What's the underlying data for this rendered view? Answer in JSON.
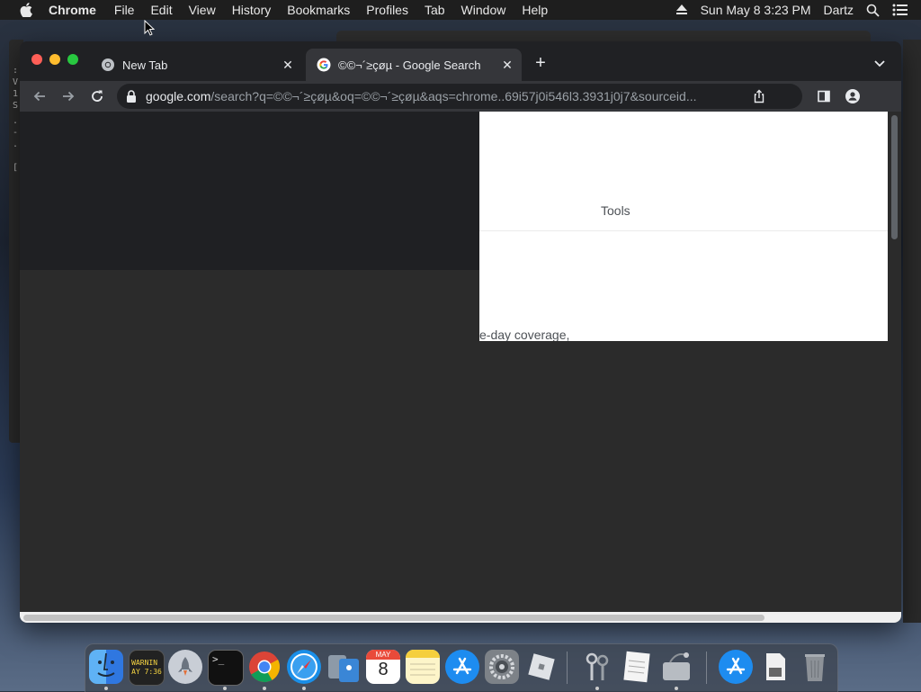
{
  "menubar": {
    "app_name": "Chrome",
    "items": [
      "File",
      "Edit",
      "View",
      "History",
      "Bookmarks",
      "Profiles",
      "Tab",
      "Window",
      "Help"
    ],
    "datetime": "Sun May 8  3:23 PM",
    "user": "Dartz"
  },
  "background_terminal": {
    "lines": [
      ":",
      "V",
      "1",
      "S",
      ".",
      "-",
      ".",
      "["
    ]
  },
  "browser": {
    "tabs": [
      {
        "label": "New Tab",
        "active": false
      },
      {
        "label": "©©¬´≥çøµ - Google Search",
        "active": true
      }
    ],
    "url_host": "google.com",
    "url_rest": "/search?q=©©¬´≥çøµ&oq=©©¬´≥çøµ&aqs=chrome..69i57j0i546l3.3931j0j7&sourceid..."
  },
  "page": {
    "tools_label": "Tools",
    "snippet_text": "e-day coverage,"
  },
  "dock": {
    "apps": [
      "finder-icon",
      "console-icon",
      "launchpad-icon",
      "terminal-icon",
      "chrome-icon",
      "safari-icon",
      "migration-icon",
      "calendar-icon",
      "notes-icon",
      "app-store-icon",
      "system-preferences-icon",
      "roblox-icon",
      "keychain-icon",
      "textedit-icon",
      "disk-utility-icon",
      "app-store-downloads-icon",
      "file-icon",
      "trash-icon"
    ],
    "console_text": "WARNIN\nAY 7:36",
    "calendar_month": "MAY",
    "calendar_day": "8"
  },
  "colors": {
    "menubar_bg": "#1e1e1e",
    "tabstrip_bg": "#202124",
    "toolbar_bg": "#35363a",
    "close_red": "#ff5f57",
    "minimize_yellow": "#febc2e",
    "maximize_green": "#28c840"
  }
}
